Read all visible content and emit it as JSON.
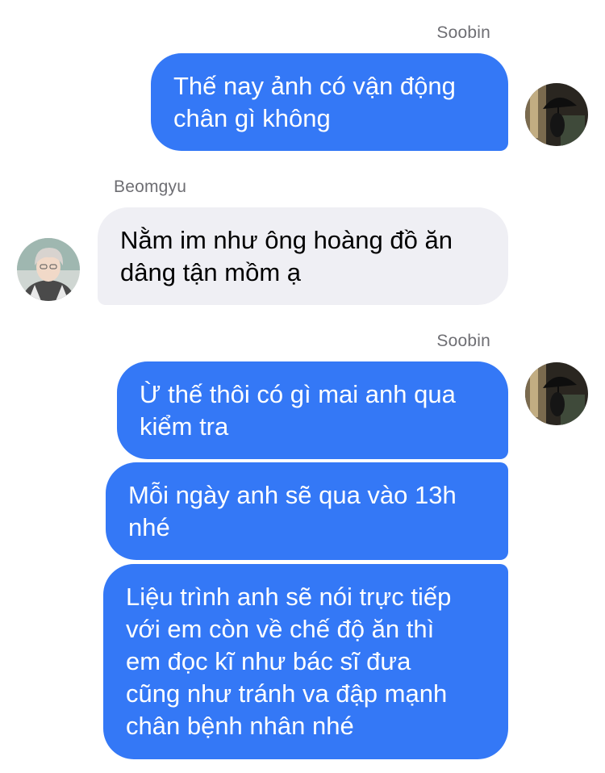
{
  "conversation": {
    "messages": [
      {
        "sender": "Soobin",
        "direction": "outgoing",
        "text": "Thế nay ảnh có vận động\nchân gì không"
      },
      {
        "sender": "Beomgyu",
        "direction": "incoming",
        "text": "Nằm im như ông hoàng đồ ăn\ndâng tận mồm ạ"
      },
      {
        "sender": "Soobin",
        "direction": "outgoing",
        "text": "Ừ thế thôi có gì mai anh qua\nkiểm tra"
      },
      {
        "sender": "Soobin",
        "direction": "outgoing",
        "text": "Mỗi ngày anh sẽ qua vào 13h\nnhé"
      },
      {
        "sender": "Soobin",
        "direction": "outgoing",
        "text": "Liệu trình anh sẽ nói trực tiếp\nvới em còn về chế độ ăn thì\nem đọc kĩ như bác sĩ đưa\ncũng như tránh va đập mạnh\nchân bệnh nhân nhé"
      }
    ]
  },
  "colors": {
    "outgoing_bubble": "#3478f6",
    "incoming_bubble": "#efeff4",
    "outgoing_text": "#ffffff",
    "incoming_text": "#000000",
    "sender_name": "#6e6e73"
  }
}
